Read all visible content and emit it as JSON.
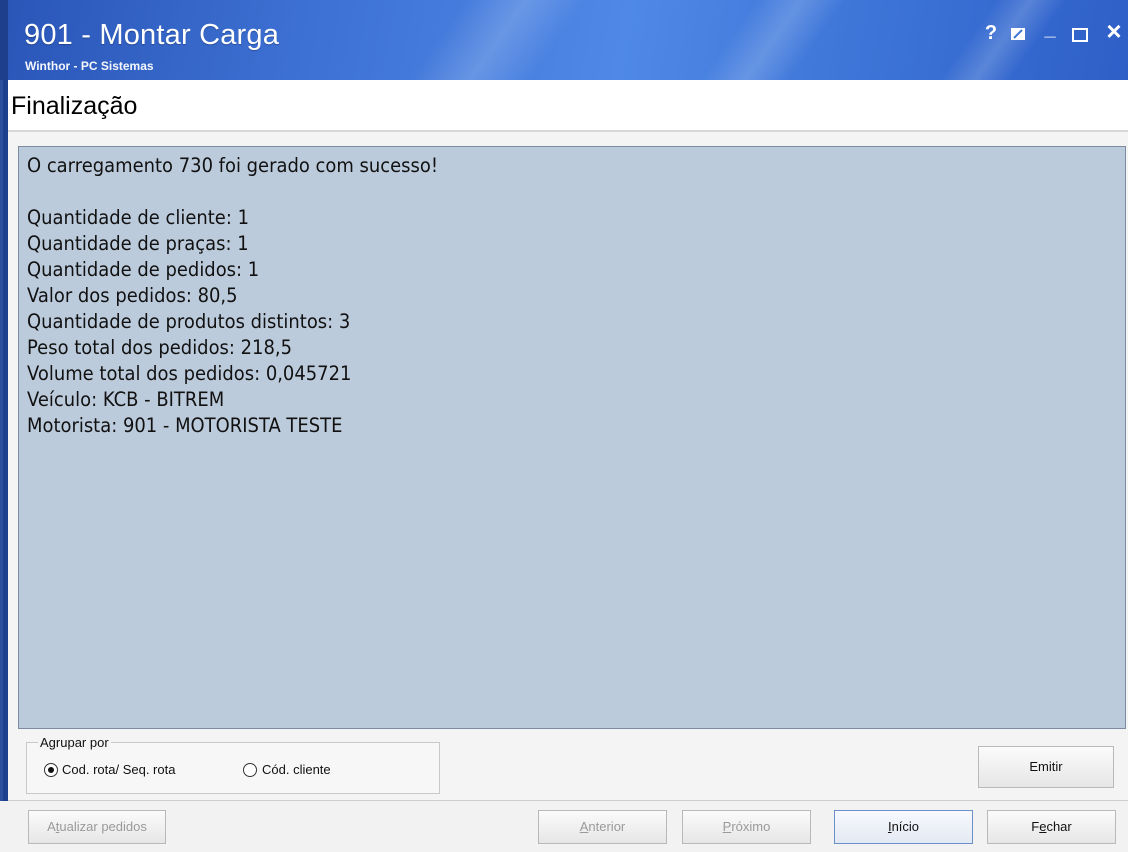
{
  "window": {
    "title": "901 - Montar Carga",
    "subtitle": "Winthor - PC Sistemas",
    "controls": {
      "help_label": "?",
      "minimize_label": "_",
      "close_label": "×"
    }
  },
  "page": {
    "title": "Finalização"
  },
  "message": {
    "headline": "O carregamento 730 foi gerado com sucesso!",
    "lines": [
      "Quantidade de cliente: 1",
      "Quantidade de praças: 1",
      "Quantidade de pedidos: 1",
      "Valor dos pedidos: 80,5",
      "Quantidade de produtos distintos: 3",
      "Peso total dos pedidos: 218,5",
      "Volume total dos pedidos: 0,045721",
      "Veículo: KCB - BITREM",
      "Motorista: 901 - MOTORISTA TESTE"
    ]
  },
  "group_by": {
    "legend": "Agrupar por",
    "options": [
      {
        "label": "Cod. rota/ Seq. rota",
        "selected": true
      },
      {
        "label": "Cód. cliente",
        "selected": false
      }
    ]
  },
  "buttons": {
    "emitir": "Emitir",
    "atualizar": {
      "before": "A",
      "accel": "t",
      "after": "ualizar pedidos"
    },
    "anterior": {
      "before": "",
      "accel": "A",
      "after": "nterior"
    },
    "proximo": {
      "before": "",
      "accel": "P",
      "after": "róximo"
    },
    "inicio": {
      "before": "",
      "accel": "I",
      "after": "nício"
    },
    "fechar": {
      "before": "F",
      "accel": "e",
      "after": "char"
    }
  },
  "colors": {
    "titlebar": "#3f74d6",
    "message_panel": "#bccbdc"
  }
}
